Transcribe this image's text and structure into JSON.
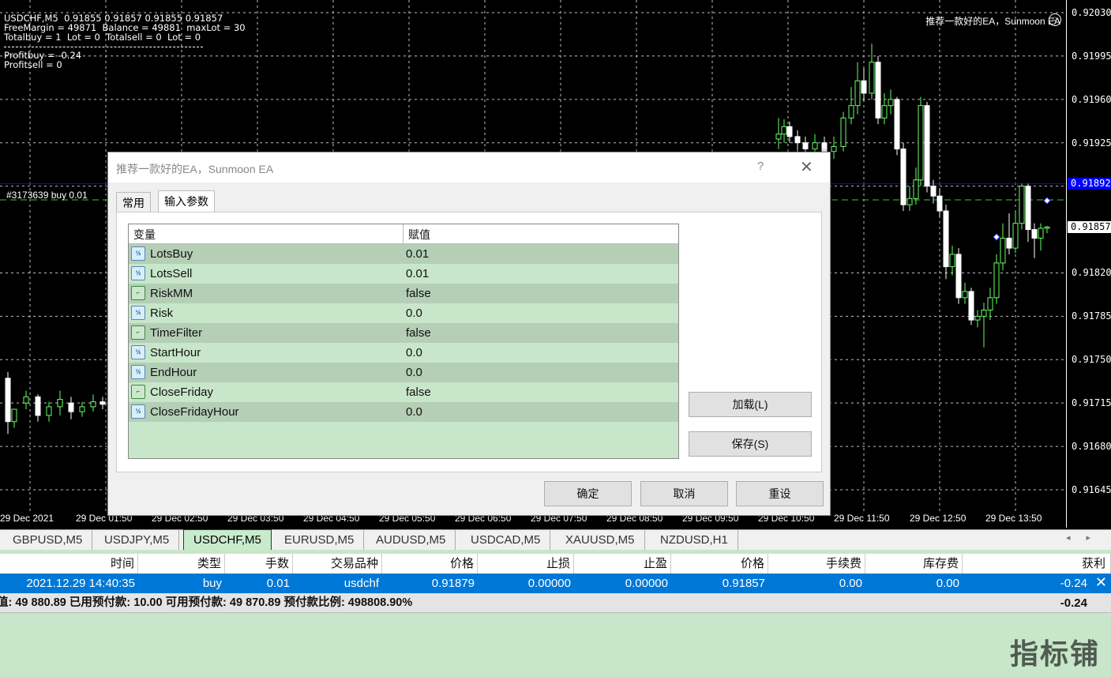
{
  "chart": {
    "symbol_line": "USDCHF,M5  0.91855 0.91857 0.91855 0.91857",
    "free_margin_line": "FreeMargin = 49871  Balance = 49881  maxLot = 30",
    "totals_line": "Totalbuy = 1  Lot = 0  Totalsell = 0  Lot = 0",
    "profit_buy": "Profitbuy = -0.24",
    "profit_sell": "Profitsell = 0",
    "ea_name": "推荐一款好的EA，Sunmoon EA",
    "order_label": "#3173639 buy 0.01",
    "current_price": "0.91857",
    "order_price": "0.91892",
    "price_ticks": [
      "0.92030",
      "0.91995",
      "0.91960",
      "0.91925",
      "0.91890",
      "0.91857",
      "0.91820",
      "0.91785",
      "0.91750",
      "0.91715",
      "0.91680",
      "0.91645"
    ],
    "time_ticks": [
      "29 Dec 2021",
      "29 Dec 01:50",
      "29 Dec 02:50",
      "29 Dec 03:50",
      "29 Dec 04:50",
      "29 Dec 05:50",
      "29 Dec 06:50",
      "29 Dec 07:50",
      "29 Dec 08:50",
      "29 Dec 09:50",
      "29 Dec 10:50",
      "29 Dec 11:50",
      "29 Dec 12:50",
      "29 Dec 13:50"
    ],
    "colors": {
      "bull": "#66ff66",
      "bear": "#ffffff",
      "grid": "#c0c0c0",
      "order_line": "#0000ff"
    }
  },
  "chart_tabs": [
    "GBPUSD,M5",
    "USDJPY,M5",
    "USDCHF,M5",
    "EURUSD,M5",
    "AUDUSD,M5",
    "USDCAD,M5",
    "XAUUSD,M5",
    "NZDUSD,H1"
  ],
  "active_tab": "USDCHF,M5",
  "dialog": {
    "title": "推荐一款好的EA，Sunmoon EA",
    "help": "?",
    "close": "✕",
    "tabs": {
      "general": "常用",
      "inputs": "输入参数"
    },
    "columns": {
      "variable": "变量",
      "value": "赋值"
    },
    "params": [
      {
        "name": "LotsBuy",
        "value": "0.01",
        "type": "num"
      },
      {
        "name": "LotsSell",
        "value": "0.01",
        "type": "num"
      },
      {
        "name": "RiskMM",
        "value": "false",
        "type": "bool"
      },
      {
        "name": "Risk",
        "value": "0.0",
        "type": "num"
      },
      {
        "name": "TimeFilter",
        "value": "false",
        "type": "bool"
      },
      {
        "name": "StartHour",
        "value": "0.0",
        "type": "num"
      },
      {
        "name": "EndHour",
        "value": "0.0",
        "type": "num"
      },
      {
        "name": "CloseFriday",
        "value": "false",
        "type": "bool"
      },
      {
        "name": "CloseFridayHour",
        "value": "0.0",
        "type": "num"
      }
    ],
    "buttons": {
      "load": "加载(L)",
      "save": "保存(S)",
      "ok": "确定",
      "cancel": "取消",
      "reset": "重设"
    }
  },
  "terminal": {
    "headers": [
      "时间",
      "类型",
      "手数",
      "交易品种",
      "价格",
      "止损",
      "止盈",
      "价格",
      "手续费",
      "库存费",
      "获利"
    ],
    "row": [
      "2021.12.29 14:40:35",
      "buy",
      "0.01",
      "usdchf",
      "0.91879",
      "0.00000",
      "0.00000",
      "0.91857",
      "0.00",
      "0.00",
      "-0.24"
    ],
    "summary": "值: 49 880.89  已用预付款: 10.00  可用预付款: 49 870.89  预付款比例: 498808.90%",
    "summary_profit": "-0.24"
  },
  "watermark": "指标铺"
}
